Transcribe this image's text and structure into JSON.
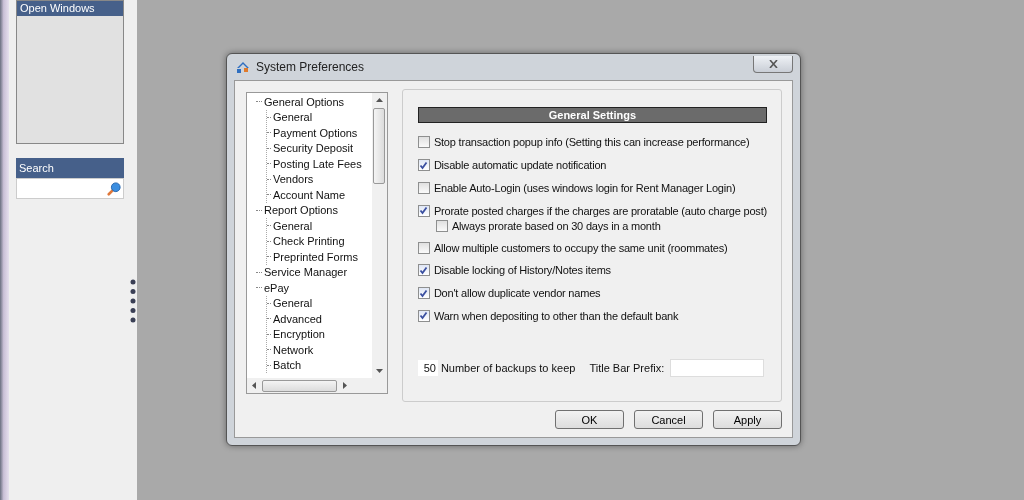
{
  "sidebar": {
    "open_windows": {
      "title": "Open Windows"
    },
    "search": {
      "title": "Search"
    }
  },
  "dialog": {
    "title": "System Preferences",
    "tree": [
      {
        "label": "General Options",
        "children": [
          {
            "label": "General"
          },
          {
            "label": "Payment Options"
          },
          {
            "label": "Security Deposit"
          },
          {
            "label": "Posting Late Fees"
          },
          {
            "label": "Vendors"
          },
          {
            "label": "Account Name"
          }
        ]
      },
      {
        "label": "Report Options",
        "children": [
          {
            "label": "General"
          },
          {
            "label": "Check Printing"
          },
          {
            "label": "Preprinted Forms"
          }
        ]
      },
      {
        "label": "Service Manager"
      },
      {
        "label": "ePay",
        "children": [
          {
            "label": "General"
          },
          {
            "label": "Advanced"
          },
          {
            "label": "Encryption"
          },
          {
            "label": "Network"
          },
          {
            "label": "Batch"
          }
        ]
      }
    ],
    "section_title": "General Settings",
    "options": [
      {
        "label": "Stop transaction popup info (Setting this can increase performance)",
        "checked": false
      },
      {
        "label": "Disable automatic update notification",
        "checked": true
      },
      {
        "label": "Enable Auto-Login (uses windows login for Rent Manager Login)",
        "checked": false
      },
      {
        "label": "Prorate posted charges if the charges are proratable (auto charge post)",
        "checked": true,
        "children": [
          {
            "label": "Always prorate based on 30 days in a month",
            "checked": false
          }
        ]
      },
      {
        "label": "Allow multiple customers to occupy the same unit (roommates)",
        "checked": false
      },
      {
        "label": "Disable locking of History/Notes items",
        "checked": true
      },
      {
        "label": "Don't allow duplicate vendor names",
        "checked": true
      },
      {
        "label": "Warn when depositing to other than the default bank",
        "checked": true
      }
    ],
    "backups": {
      "value": "50",
      "label": "Number of backups to keep"
    },
    "prefix": {
      "label": "Title Bar Prefix:"
    },
    "buttons": [
      "OK",
      "Cancel",
      "Apply"
    ]
  }
}
